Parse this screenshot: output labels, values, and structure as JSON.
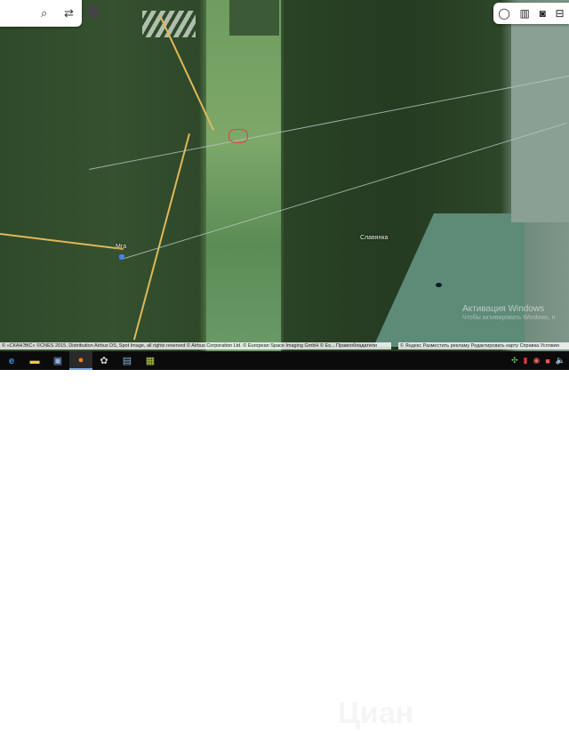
{
  "map": {
    "labels": [
      "Мга",
      "Славянка"
    ],
    "attribution_left": "© «СКАНЭКС» ©CNES 2015, Distribution Airbus DS, Spot Image, all rights reserved © Airbus Corporation Ltd. © European Space Imaging GmbH © Es...   Правообладатели",
    "attribution_right": "© Яндекс  Разместить рекламу  Редактировать карту  Справка  Условия",
    "activation_title": "Активация Windows",
    "activation_sub": "Чтобы активировать Windows, п",
    "watermark": "Циан"
  },
  "search": {
    "search_icon": "search-icon",
    "route_icon": "route-icon"
  },
  "tools": [
    "layers-icon",
    "traffic-icon",
    "camera-icon",
    "transport-icon"
  ],
  "taskbar": {
    "apps": [
      "edge-icon",
      "file-explorer-icon",
      "photo-app-icon",
      "firefox-icon",
      "media-app-icon",
      "notepad-icon",
      "archive-icon"
    ],
    "tray": [
      "app-tray-icon",
      "shield-tray-icon",
      "network-tray-icon",
      "office-tray-icon",
      "volume-icon"
    ]
  }
}
